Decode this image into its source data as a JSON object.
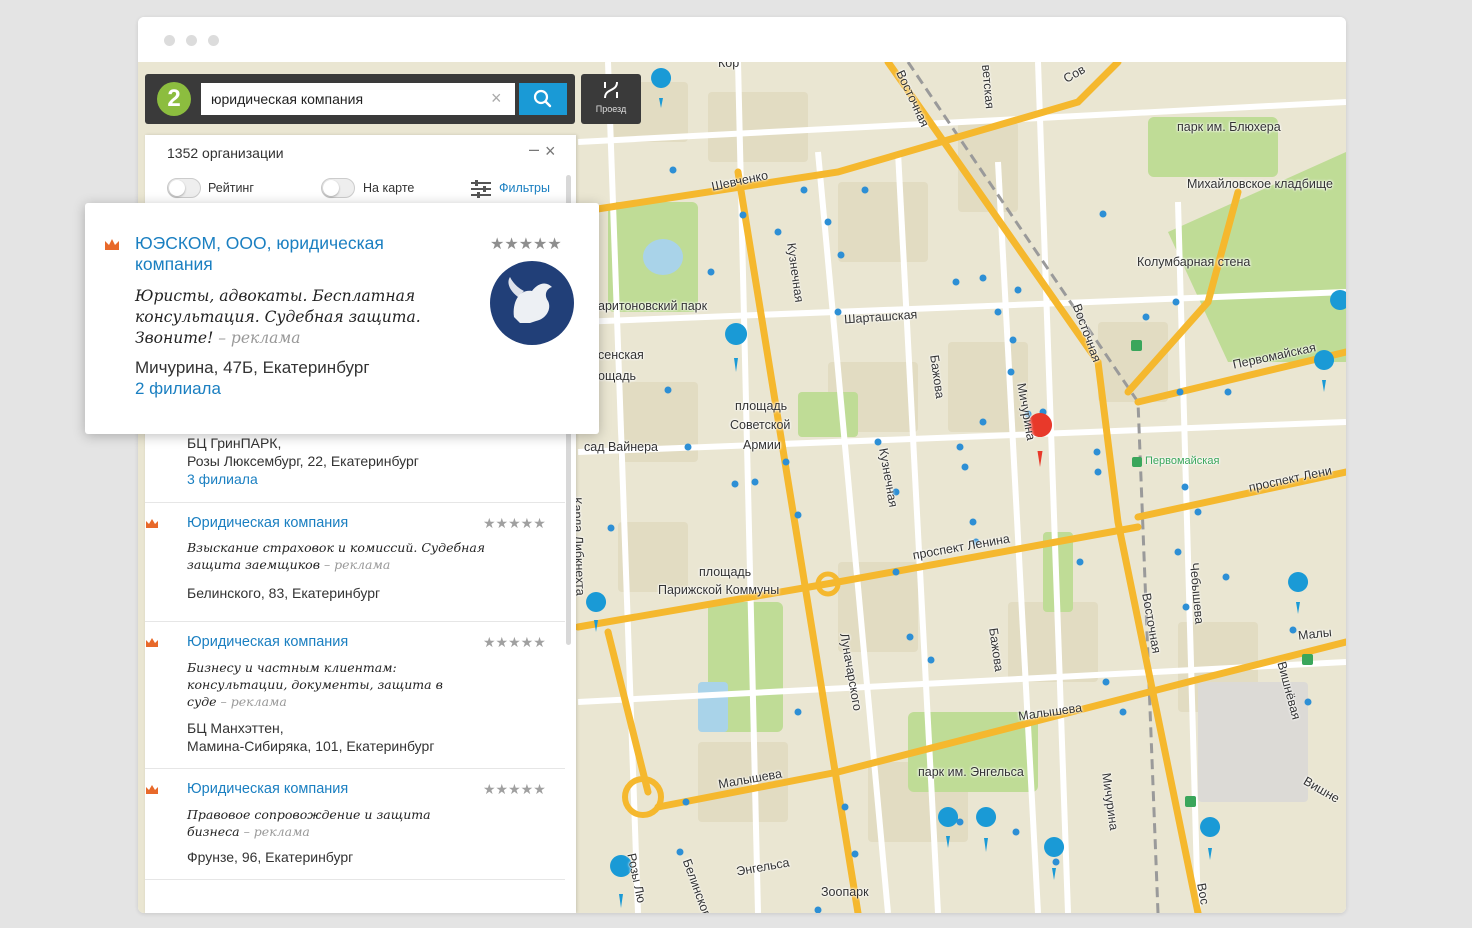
{
  "search": {
    "query": "юридическая компания",
    "route_label": "Проезд"
  },
  "panel": {
    "count_text": "1352 организации",
    "toggle_rating": "Рейтинг",
    "toggle_map": "На карте",
    "filters": "Фильтры",
    "minimize": "–",
    "close": "×"
  },
  "popup": {
    "title": "ЮЭСКОМ, ООО, юридическая компания",
    "stars": "★★★★★",
    "ad_text": "Юристы, адвокаты. Бесплатная консультация. Судебная защита. Звоните!",
    "ad_tag": " – реклама",
    "address": "Мичурина, 47Б, Екатеринбург",
    "branches": "2 филиала"
  },
  "items": [
    {
      "address_line1": "БЦ ГринПАРК,",
      "address_line2": "Розы Люксембург, 22, Екатеринбург",
      "branches": "3 филиала"
    },
    {
      "name": "Юридическая компания",
      "stars": "★★★★★",
      "ad_text": "Взыскание страховок и комиссий. Судебная защита заемщиков",
      "ad_tag": " – реклама",
      "address_line1": "Белинского, 83, Екатеринбург"
    },
    {
      "name": "Юридическая компания",
      "stars": "★★★★★",
      "ad_text": "Бизнесу и частным клиентам: консультации, документы, защита в суде",
      "ad_tag": " – реклама",
      "address_line1": "БЦ Манхэттен,",
      "address_line2": "Мамина-Сибиряка, 101, Екатеринбург"
    },
    {
      "name": "Юридическая компания",
      "stars": "★★★★★",
      "ad_text": "Правовое сопровождение и защита бизнеса",
      "ad_tag": " – реклама",
      "address_line1": "Фрунзе, 96, Екатеринбург"
    }
  ],
  "map_labels": {
    "shevchenko": "Шевченко",
    "kharitonovsky": "аритоновский парк",
    "sensk": "сенская",
    "loshchad": "ощадь",
    "sad_vainera": "сад Вайнера",
    "kuznechnaya1": "Кузнечная",
    "kuznechnaya2": "Кузнечная",
    "shartashskaya": "Шарташская",
    "bazhova1": "Бажова",
    "bazhova2": "Бажова",
    "michurina1": "Мичурина",
    "michurina2": "Мичурина",
    "ploshchad_sa1": "площадь",
    "ploshchad_sa2": "Советской",
    "ploshchad_sa3": "Армии",
    "vostochnaya1": "Восточная",
    "vostochnaya2": "Восточная",
    "vostochnaya3": "Восточная",
    "vostochnaya4": "Вос",
    "park_blyukhera": "парк им. Блюхера",
    "mikhailovskoe": "Михайловское кладбище",
    "kolumbarnaya": "Колумбарная стена",
    "pervomaiskaya": "Первомайская",
    "pervomaiskaya_st": "Первомайская",
    "prospekt_lenina1": "проспект Ленина",
    "prospekt_lenina2": "проспект Лени",
    "ploshchad_pk1": "площадь",
    "ploshchad_pk2": "Парижской Коммуны",
    "karla_libknekhta": "Карла Либкнехта",
    "lunacharskogo": "Луначарского",
    "chebysheva": "Чебышева",
    "malysheva1": "Малышева",
    "malysheva2": "Малышева",
    "malysheva3": "Малы",
    "vishnevaya1": "Вишнёвая",
    "vishnevaya2": "Вишне",
    "park_engelsa": "парк им. Энгельса",
    "engelsa": "Энгельса",
    "zoopark": "Зоопарк",
    "belinskogo": "Белинского",
    "rozy": "Розы Лю",
    "vetskaya": "ветская",
    "sov": "Сов",
    "kor": "Кор"
  },
  "colors": {
    "accent": "#1a9ad6",
    "link": "#1a7fc1",
    "crown": "#e8692a",
    "road_major": "#f5b82e",
    "park": "#bfdc96"
  }
}
